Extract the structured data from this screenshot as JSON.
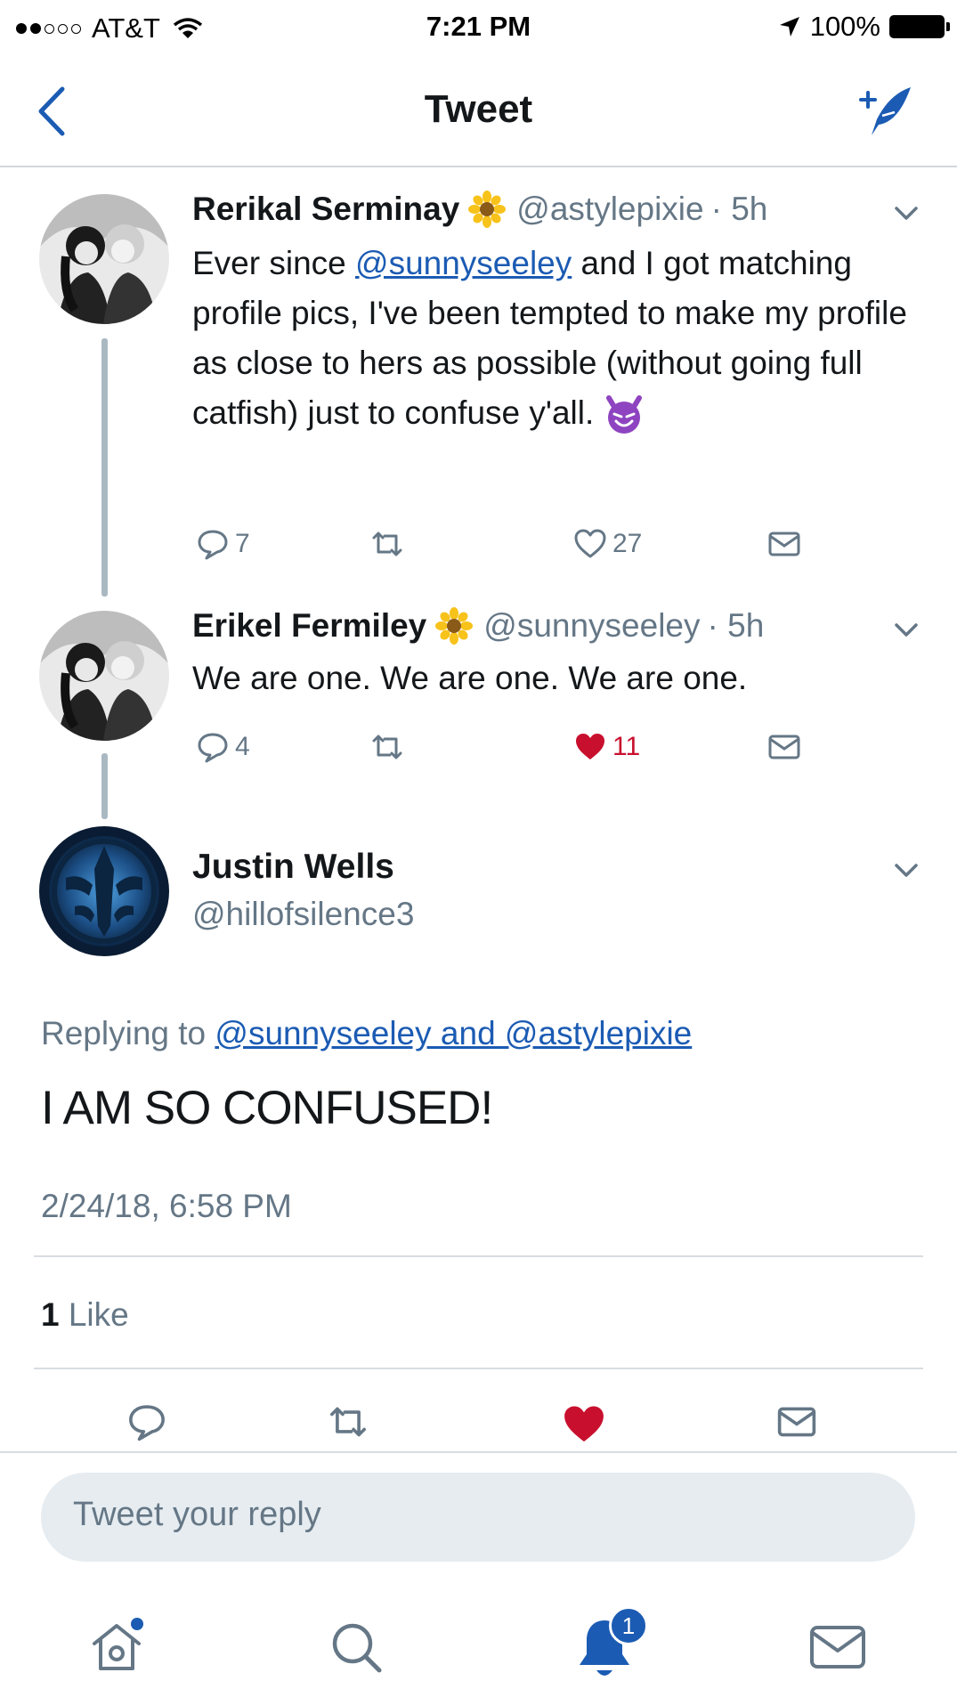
{
  "status_bar": {
    "carrier": "AT&T",
    "time": "7:21 PM",
    "battery": "100%"
  },
  "nav": {
    "title": "Tweet"
  },
  "thread": [
    {
      "name": "Rerikal Serminay",
      "handle": "@astylepixie",
      "time": "· 5h",
      "text_parts": [
        "Ever since ",
        "@sunnyseeley",
        " and I got matching profile pics, I've been tempted to make my profile as close to hers as possible (without going full catfish) just to confuse y'all."
      ],
      "replies": "7",
      "likes": "27",
      "liked": false
    },
    {
      "name": "Erikel Fermiley",
      "handle": "@sunnyseeley",
      "time": "· 5h",
      "text": "We are one. We are one. We are one.",
      "replies": "4",
      "likes": "11",
      "liked": true
    }
  ],
  "focus_tweet": {
    "name": "Justin Wells",
    "handle": "@hillofsilence3",
    "replying_label": "Replying to ",
    "replying_to": "@sunnyseeley and @astylepixie",
    "text": "I AM SO CONFUSED!",
    "timestamp": "2/24/18, 6:58 PM",
    "like_count": "1",
    "like_label": "Like"
  },
  "reply_box": {
    "placeholder": "Tweet your reply"
  },
  "tab_bar": {
    "notifications_badge": "1"
  },
  "colors": {
    "accent": "#1b5bb3",
    "like_red": "#c8102e",
    "muted": "#657786"
  }
}
